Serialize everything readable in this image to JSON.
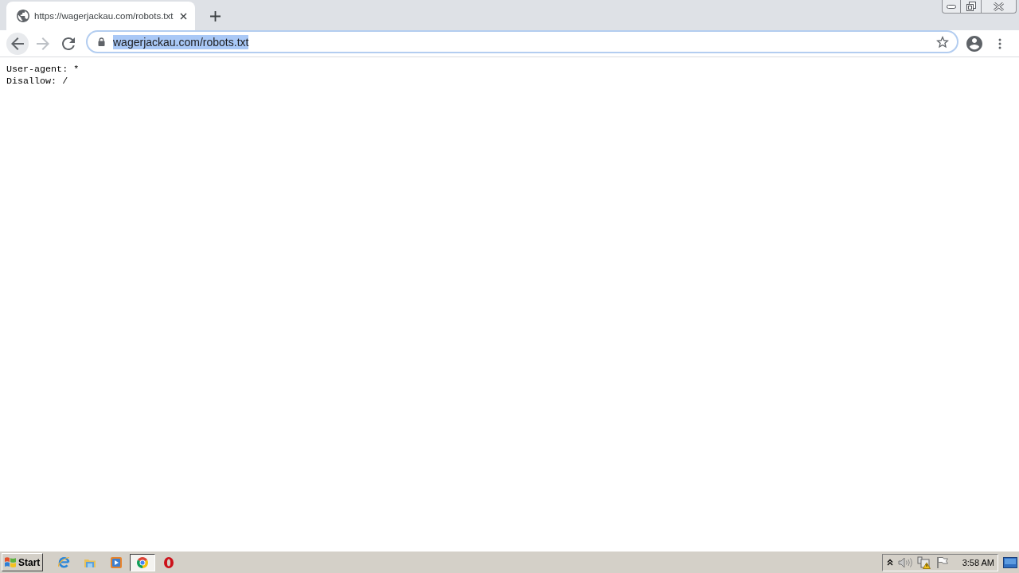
{
  "browser": {
    "tabs": [
      {
        "title": "https://wagerjackau.com/robots.txt",
        "selected": true
      }
    ],
    "toolbar": {
      "back": {
        "disabled": false
      },
      "forward": {
        "disabled": true
      }
    },
    "address_bar": {
      "url": "wagerjackau.com/robots.txt",
      "text_selected": true
    }
  },
  "page": {
    "lines": [
      "User-agent: *",
      "Disallow: /"
    ]
  },
  "taskbar": {
    "start": "Start",
    "apps": [
      {
        "kind": "ie",
        "selected": false
      },
      {
        "kind": "explorer",
        "selected": false
      },
      {
        "kind": "media",
        "selected": false
      },
      {
        "kind": "chrome",
        "selected": true
      },
      {
        "kind": "opera",
        "selected": false
      }
    ],
    "clock": "3:58 AM"
  }
}
